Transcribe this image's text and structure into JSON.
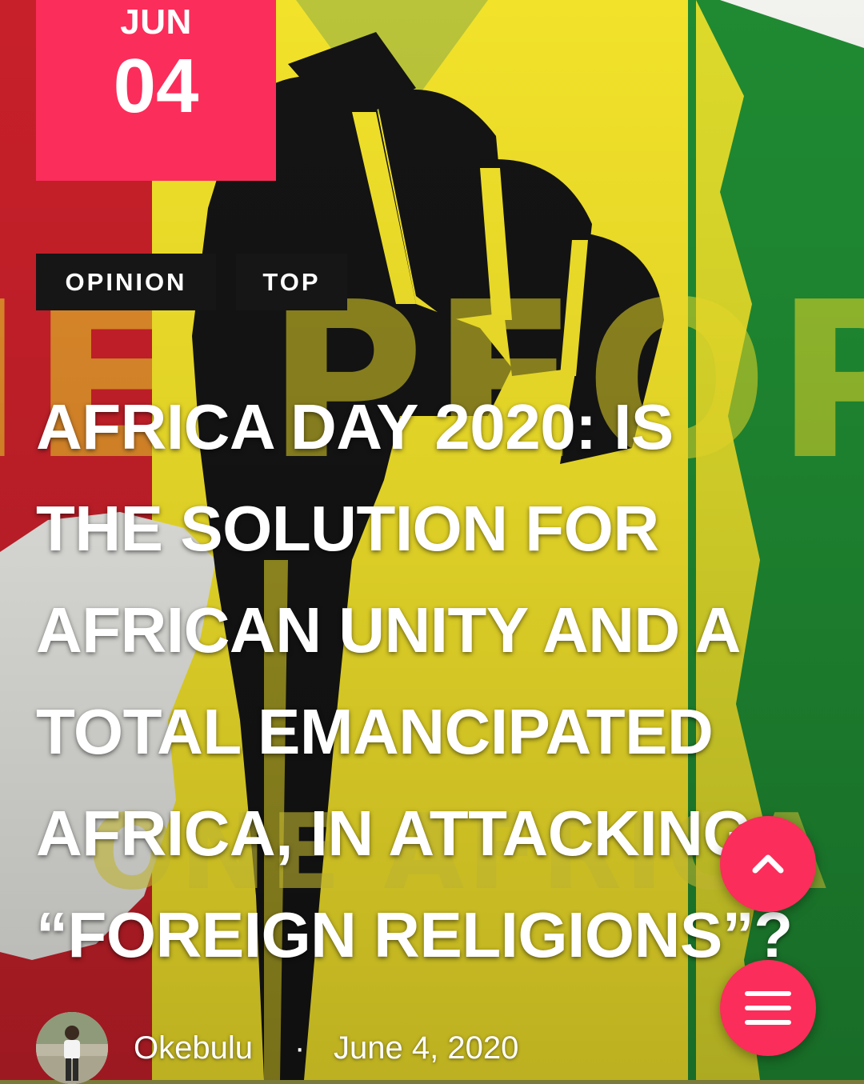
{
  "post": {
    "date": {
      "month": "JUN",
      "day": "04"
    },
    "categories": [
      {
        "label": "OPINION"
      },
      {
        "label": "TOP"
      }
    ],
    "title_lines": [
      "AFRICA DAY 2020: IS",
      "THE SOLUTION FOR",
      "AFRICAN UNITY AND A",
      "TOTAL EMANCIPATED",
      "AFRICA, IN ATTACKING",
      "“FOREIGN RELIGIONS”?"
    ],
    "author": "Okebulu",
    "separator": "·",
    "published": "June 4, 2020"
  },
  "hero_image": {
    "depicts": "raised fist over red, yellow and green panels",
    "background_lettering": [
      "THE PEOPLE",
      "ONE AFRICA"
    ]
  },
  "buttons": {
    "scroll_top_icon": "chevron-up-icon",
    "menu_icon": "hamburger-menu-icon"
  },
  "colors": {
    "accent": "#fb2d5a",
    "tag_background": "#161616",
    "text": "#ffffff",
    "flag_red": "#c8202a",
    "flag_yellow": "#f2e22a",
    "flag_green": "#1f8a32",
    "fist": "#161616"
  }
}
